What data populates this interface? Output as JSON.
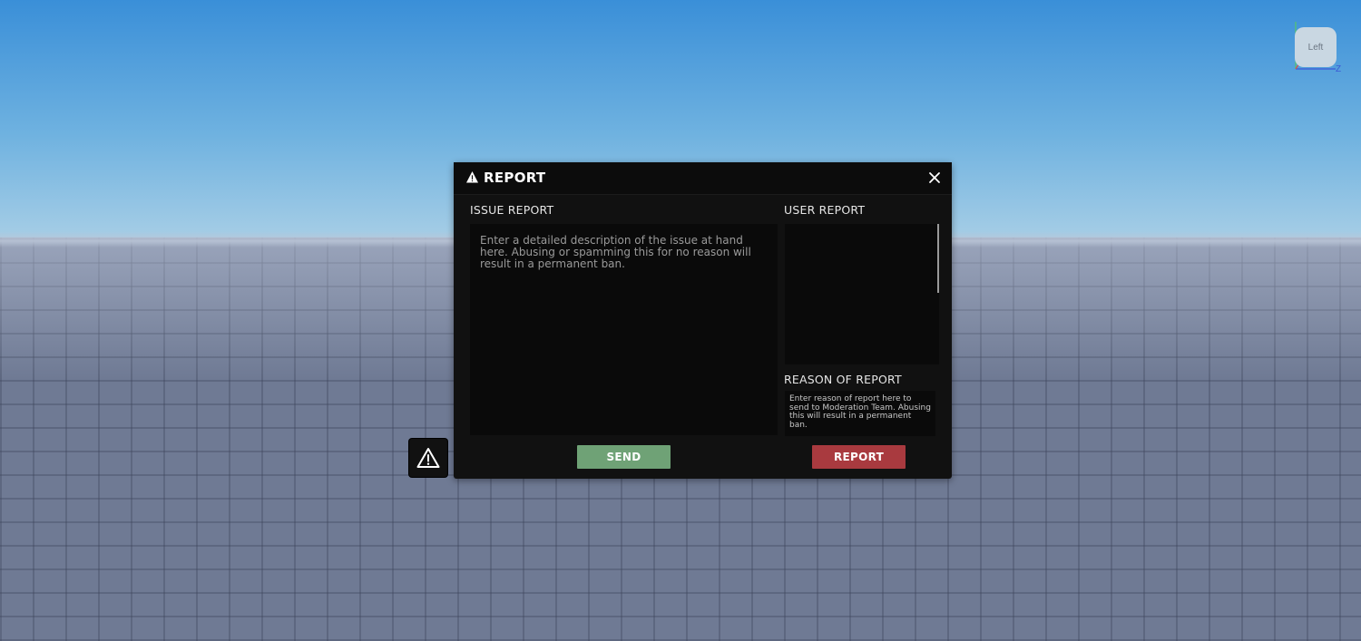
{
  "viewport": {
    "view_cube_label": "Left",
    "axis_label": "Z"
  },
  "launcher": {
    "icon": "warning-triangle-icon"
  },
  "modal": {
    "title": "REPORT",
    "title_icon": "warning-triangle-icon",
    "close_icon": "close-icon",
    "issue_report": {
      "label": "ISSUE REPORT",
      "value": "",
      "placeholder": "Enter a detailed description of the issue at hand here. Abusing or spamming this for no reason will result in a permanent ban."
    },
    "user_report": {
      "label": "USER REPORT",
      "items": []
    },
    "reason_of_report": {
      "label": "REASON OF REPORT",
      "value": "",
      "placeholder": "Enter reason of report here to send to Moderation Team. Abusing this will result in a permanent ban."
    },
    "send_button": "SEND",
    "report_button": "REPORT"
  },
  "colors": {
    "send": "#6fa276",
    "report": "#a93a3f",
    "modal_bg": "#111111"
  }
}
